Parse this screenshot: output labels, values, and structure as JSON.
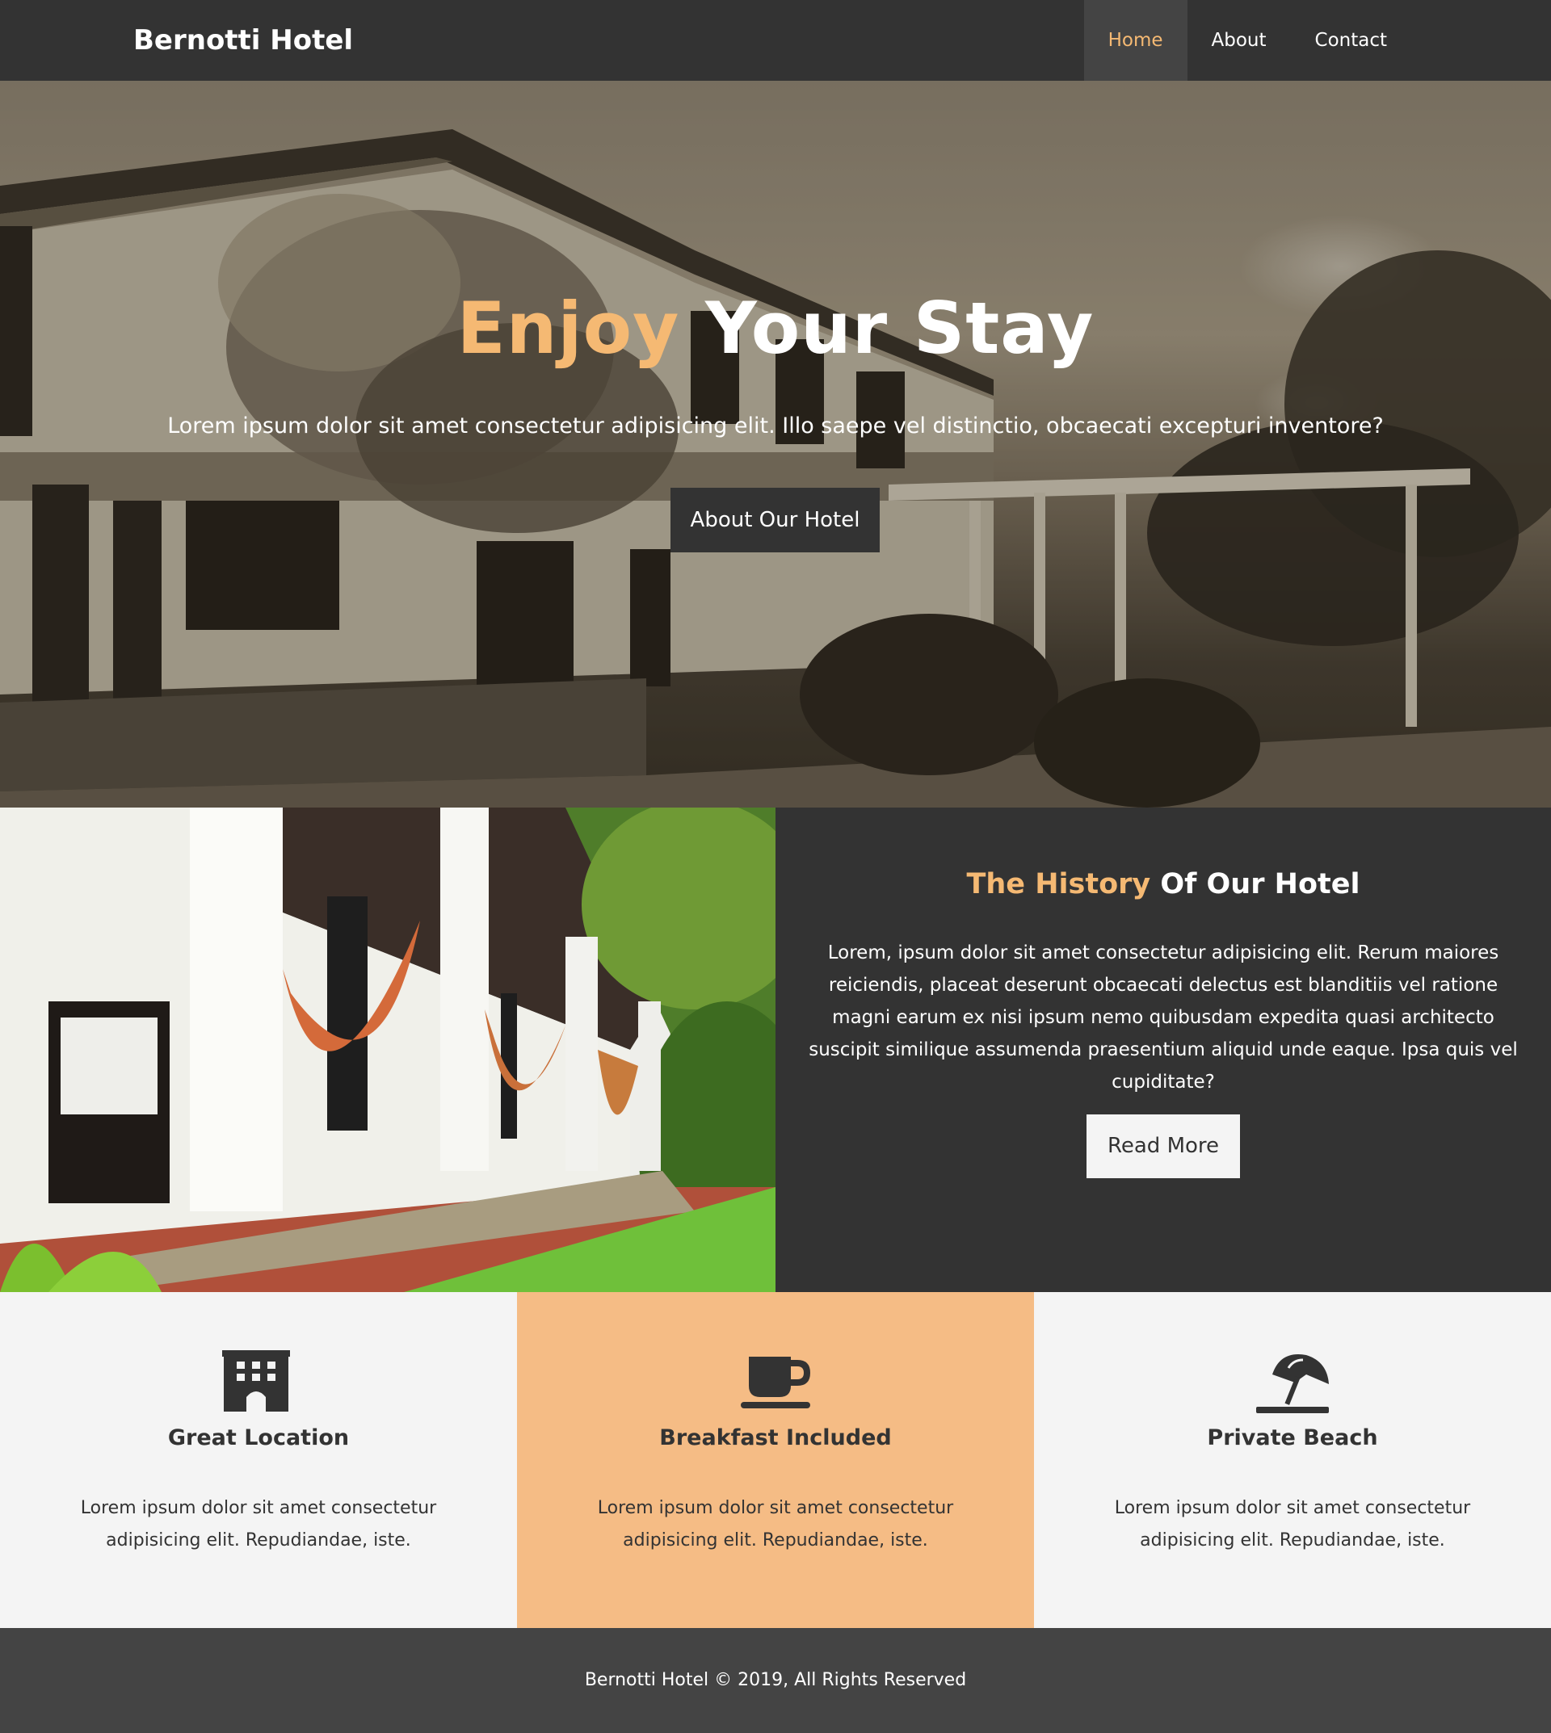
{
  "brand": "Bernotti Hotel",
  "nav": [
    {
      "label": "Home",
      "active": true
    },
    {
      "label": "About",
      "active": false
    },
    {
      "label": "Contact",
      "active": false
    }
  ],
  "hero": {
    "title_accent": "Enjoy",
    "title_rest": " Your Stay",
    "subtitle": "Lorem ipsum dolor sit amet consectetur adipisicing elit. Illo saepe vel distinctio, obcaecati excepturi inventore?",
    "button": "About Our Hotel"
  },
  "history": {
    "title_accent": "The History",
    "title_rest": " Of Our Hotel",
    "text": "Lorem, ipsum dolor sit amet consectetur adipisicing elit. Rerum maiores reiciendis, placeat deserunt obcaecati delectus est blanditiis vel ratione magni earum ex nisi ipsum nemo quibusdam expedita quasi architecto suscipit similique assumenda praesentium aliquid unde eaque. Ipsa quis vel cupiditate?",
    "button": "Read More"
  },
  "features": [
    {
      "icon": "building-icon",
      "title": "Great Location",
      "text": "Lorem ipsum dolor sit amet consectetur adipisicing elit. Repudiandae, iste."
    },
    {
      "icon": "coffee-cup-icon",
      "title": "Breakfast Included",
      "text": "Lorem ipsum dolor sit amet consectetur adipisicing elit. Repudiandae, iste."
    },
    {
      "icon": "beach-umbrella-icon",
      "title": "Private Beach",
      "text": "Lorem ipsum dolor sit amet consectetur adipisicing elit. Repudiandae, iste."
    }
  ],
  "footer": "Bernotti Hotel © 2019, All Rights Reserved",
  "colors": {
    "dark": "#333333",
    "accent": "#f5b973",
    "light": "#f4f4f4",
    "feature_highlight": "#f5bc85",
    "footer": "#444444"
  }
}
